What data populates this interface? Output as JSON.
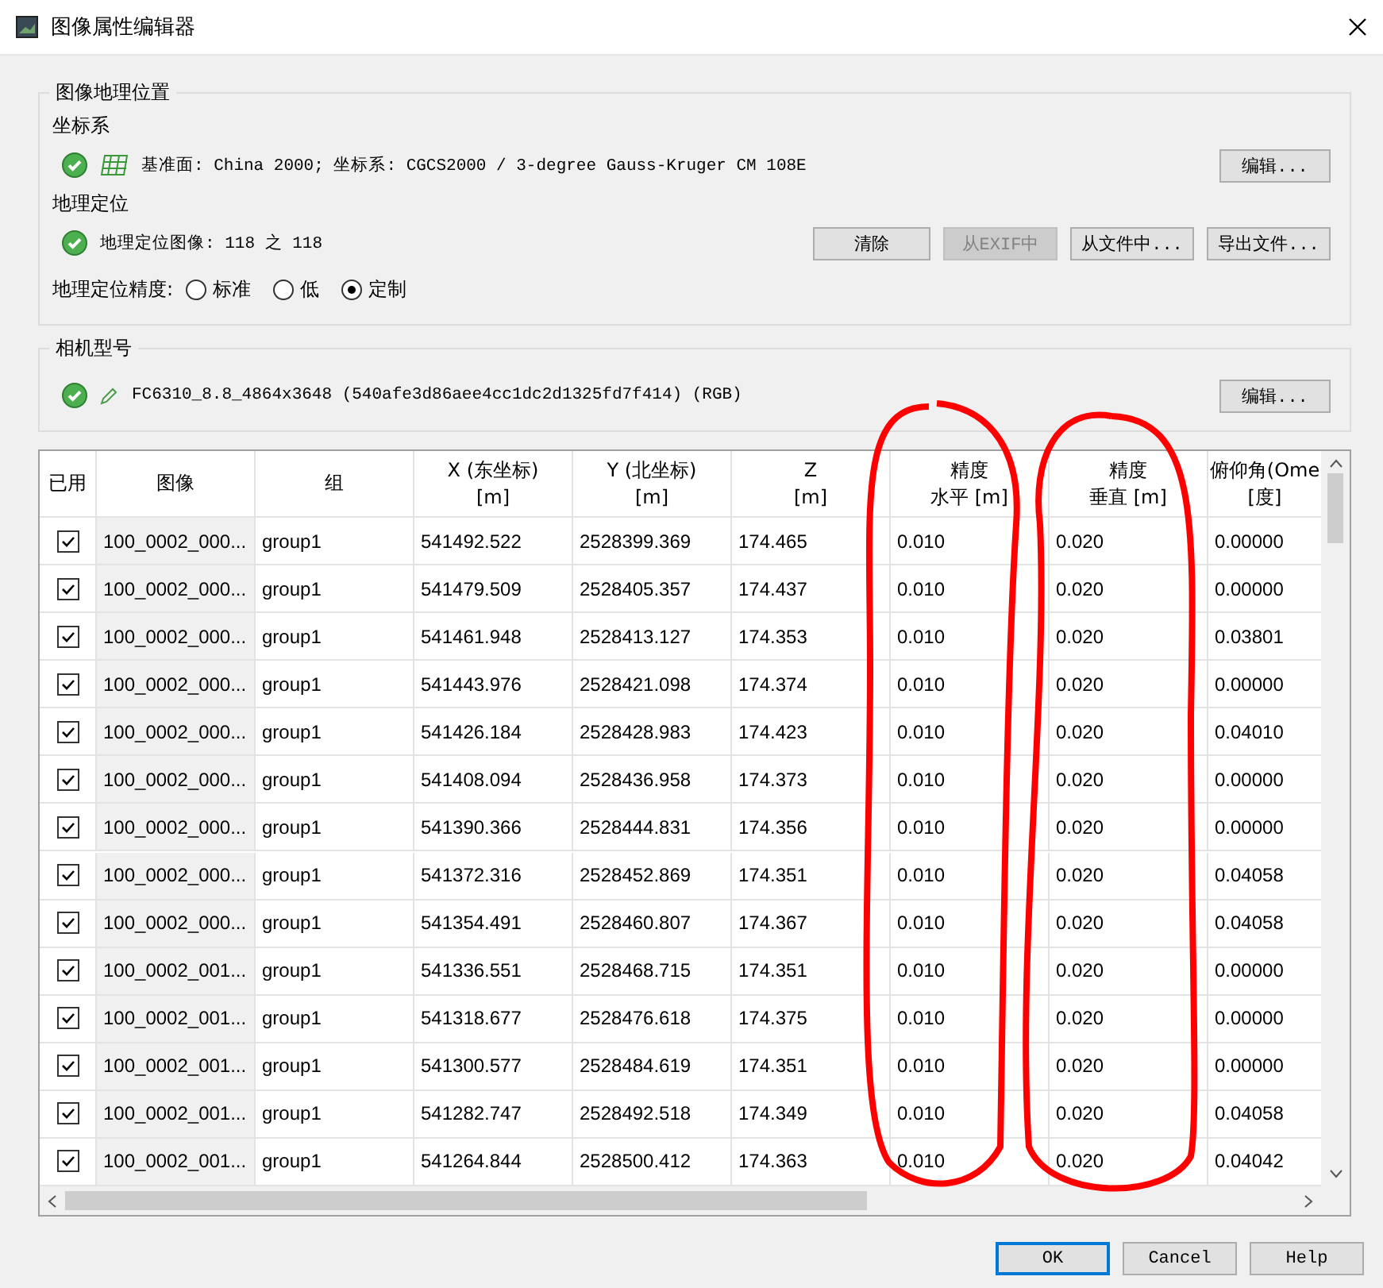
{
  "window": {
    "title": "图像属性编辑器"
  },
  "geolocation": {
    "title": "图像地理位置",
    "coordinate_system": {
      "label": "坐标系",
      "ok": true,
      "text": "基准面: China 2000; 坐标系: CGCS2000 / 3-degree Gauss-Kruger CM 108E",
      "button": "编辑..."
    },
    "georeference": {
      "label": "地理定位",
      "ok": true,
      "text": "地理定位图像: 118 之 118",
      "buttons": [
        {
          "label": "清除",
          "disabled": false
        },
        {
          "label": "从EXIF中",
          "disabled": true
        },
        {
          "label": "从文件中...",
          "disabled": false
        },
        {
          "label": "导出文件...",
          "disabled": false
        }
      ]
    },
    "accuracy": {
      "label": "地理定位精度:",
      "options": [
        {
          "label": "标准",
          "selected": false
        },
        {
          "label": "低",
          "selected": false
        },
        {
          "label": "定制",
          "selected": true
        }
      ]
    }
  },
  "camera": {
    "title": "相机型号",
    "ok": true,
    "text": "FC6310_8.8_4864x3648 (540afe3d86aee4cc1dc2d1325fd7f414) (RGB)",
    "button": "编辑..."
  },
  "table": {
    "checkbox_column": {
      "title": "已用"
    },
    "columns": [
      {
        "title": "图像"
      },
      {
        "title": "组"
      },
      {
        "title": "X (东坐标)",
        "unit": "[m]"
      },
      {
        "title": "Y (北坐标)",
        "unit": "[m]"
      },
      {
        "title": "Z",
        "unit": "[m]"
      },
      {
        "title": "精度",
        "unit": "水平 [m]"
      },
      {
        "title": "精度",
        "unit": "垂直 [m]"
      },
      {
        "title": "俯仰角(Ome",
        "unit": "[度]"
      }
    ],
    "rows": [
      {
        "checked": true,
        "cells": [
          "100_0002_000...",
          "group1",
          "541492.522",
          "2528399.369",
          "174.465",
          "0.010",
          "0.020",
          "0.00000"
        ]
      },
      {
        "checked": true,
        "cells": [
          "100_0002_000...",
          "group1",
          "541479.509",
          "2528405.357",
          "174.437",
          "0.010",
          "0.020",
          "0.00000"
        ]
      },
      {
        "checked": true,
        "cells": [
          "100_0002_000...",
          "group1",
          "541461.948",
          "2528413.127",
          "174.353",
          "0.010",
          "0.020",
          "0.03801"
        ]
      },
      {
        "checked": true,
        "cells": [
          "100_0002_000...",
          "group1",
          "541443.976",
          "2528421.098",
          "174.374",
          "0.010",
          "0.020",
          "0.00000"
        ]
      },
      {
        "checked": true,
        "cells": [
          "100_0002_000...",
          "group1",
          "541426.184",
          "2528428.983",
          "174.423",
          "0.010",
          "0.020",
          "0.04010"
        ]
      },
      {
        "checked": true,
        "cells": [
          "100_0002_000...",
          "group1",
          "541408.094",
          "2528436.958",
          "174.373",
          "0.010",
          "0.020",
          "0.00000"
        ]
      },
      {
        "checked": true,
        "cells": [
          "100_0002_000...",
          "group1",
          "541390.366",
          "2528444.831",
          "174.356",
          "0.010",
          "0.020",
          "0.00000"
        ]
      },
      {
        "checked": true,
        "cells": [
          "100_0002_000...",
          "group1",
          "541372.316",
          "2528452.869",
          "174.351",
          "0.010",
          "0.020",
          "0.04058"
        ]
      },
      {
        "checked": true,
        "cells": [
          "100_0002_000...",
          "group1",
          "541354.491",
          "2528460.807",
          "174.367",
          "0.010",
          "0.020",
          "0.04058"
        ]
      },
      {
        "checked": true,
        "cells": [
          "100_0002_001...",
          "group1",
          "541336.551",
          "2528468.715",
          "174.351",
          "0.010",
          "0.020",
          "0.00000"
        ]
      },
      {
        "checked": true,
        "cells": [
          "100_0002_001...",
          "group1",
          "541318.677",
          "2528476.618",
          "174.375",
          "0.010",
          "0.020",
          "0.00000"
        ]
      },
      {
        "checked": true,
        "cells": [
          "100_0002_001...",
          "group1",
          "541300.577",
          "2528484.619",
          "174.351",
          "0.010",
          "0.020",
          "0.00000"
        ]
      },
      {
        "checked": true,
        "cells": [
          "100_0002_001...",
          "group1",
          "541282.747",
          "2528492.518",
          "174.349",
          "0.010",
          "0.020",
          "0.04058"
        ]
      },
      {
        "checked": true,
        "cells": [
          "100_0002_001...",
          "group1",
          "541264.844",
          "2528500.412",
          "174.363",
          "0.010",
          "0.020",
          "0.04042"
        ]
      }
    ]
  },
  "annotations": [
    {
      "kind": "circle"
    },
    {
      "kind": "circle"
    }
  ],
  "buttons": [
    {
      "label": "OK",
      "default": true
    },
    {
      "label": "Cancel",
      "default": false
    },
    {
      "label": "Help",
      "default": false
    }
  ]
}
